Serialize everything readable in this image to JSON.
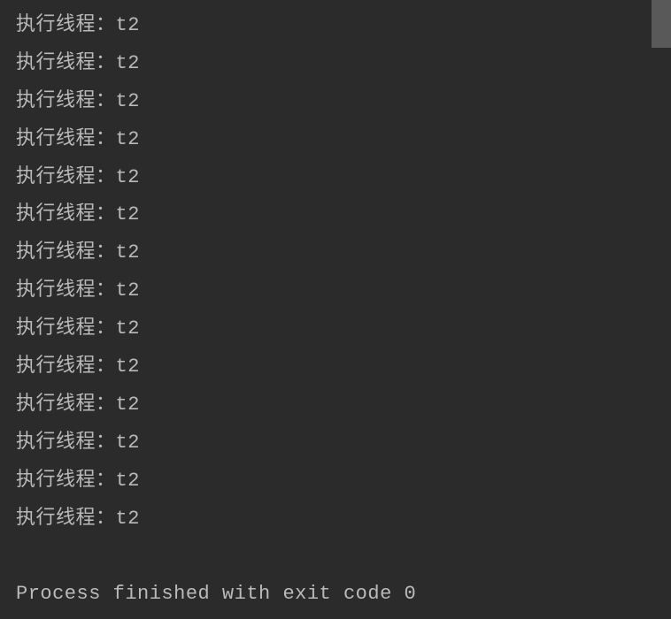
{
  "console": {
    "lines": [
      "执行线程：t2",
      "执行线程：t2",
      "执行线程：t2",
      "执行线程：t2",
      "执行线程：t2",
      "执行线程：t2",
      "执行线程：t2",
      "执行线程：t2",
      "执行线程：t2",
      "执行线程：t2",
      "执行线程：t2",
      "执行线程：t2",
      "执行线程：t2",
      "执行线程：t2"
    ],
    "exit_message": "Process finished with exit code 0"
  }
}
